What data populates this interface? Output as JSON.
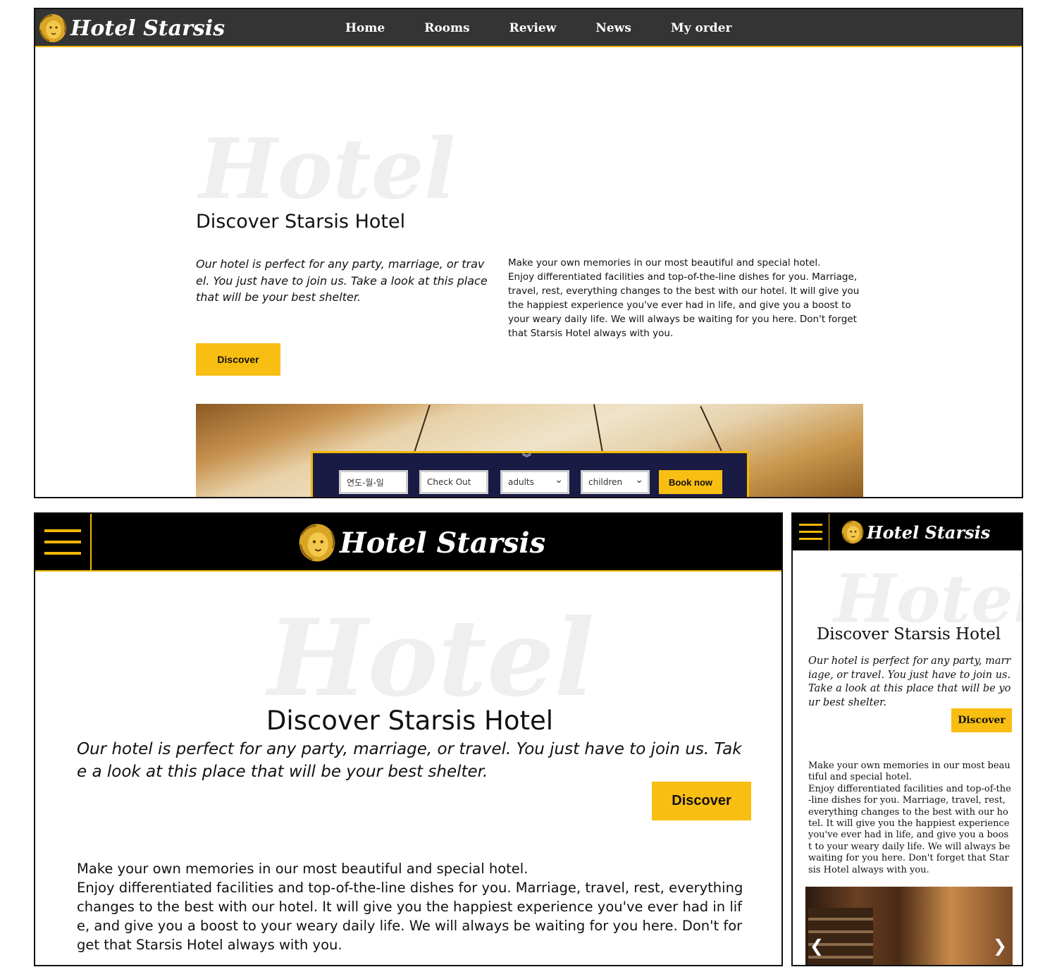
{
  "brand": {
    "name": "Hotel Starsis"
  },
  "watermark": "Hotel",
  "nav": {
    "items": [
      "Home",
      "Rooms",
      "Review",
      "News",
      "My order"
    ]
  },
  "content": {
    "title": "Discover Starsis Hotel",
    "lead": "Our hotel is perfect for any party, marriage, or travel. You just have to join us. Take a look at this place that will be your best shelter.",
    "body_line1": "Make your own memories in our most beautiful and special hotel.",
    "body_rest": "Enjoy differentiated facilities and top-of-the-line dishes for you. Marriage, travel, rest, everything changes to the best with our hotel. It will give you the happiest experience you've ever had in life, and give you a boost to your weary daily life. We will always be waiting for you here. Don't forget that Starsis Hotel always with you.",
    "discover_label": "Discover"
  },
  "booking": {
    "checkin_placeholder": "연도-월-일",
    "checkout_placeholder": "Check Out",
    "adults_label": "adults",
    "children_label": "children",
    "book_label": "Book now"
  },
  "slider": {
    "prev": "❮",
    "next": "❯"
  },
  "colors": {
    "accent": "#f9be12",
    "nav_dark": "#343434",
    "nav_black": "#000000",
    "booking_bg": "#1a1b44"
  },
  "icons": [
    "lion-logo-icon",
    "hamburger-menu-icon",
    "chevron-double-down-icon",
    "select-arrow-icon",
    "slider-prev-icon",
    "slider-next-icon"
  ]
}
